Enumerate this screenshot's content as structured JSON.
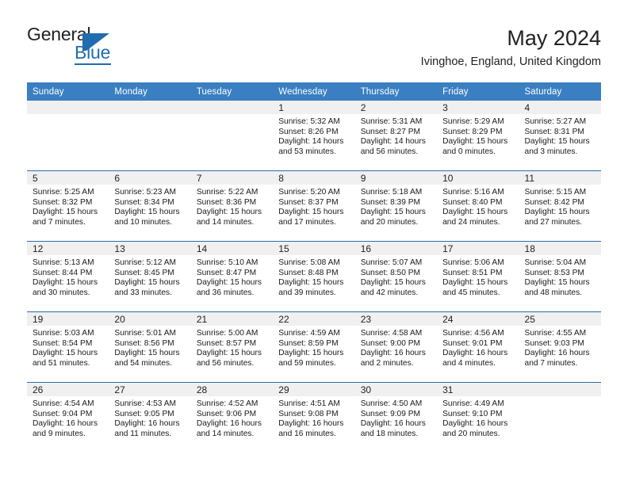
{
  "brand": {
    "name_top": "General",
    "name_bottom": "Blue",
    "accent_color": "#1f6cb0"
  },
  "header": {
    "title": "May 2024",
    "location": "Ivinghoe, England, United Kingdom"
  },
  "theme": {
    "header_blue": "#3a7fc1",
    "rule_blue": "#2b6cab",
    "daynum_band": "#f0f0f0"
  },
  "weekday_headers": [
    "Sunday",
    "Monday",
    "Tuesday",
    "Wednesday",
    "Thursday",
    "Friday",
    "Saturday"
  ],
  "weeks": [
    [
      {
        "day": "",
        "sunrise": "",
        "sunset": "",
        "daylight1": "",
        "daylight2": ""
      },
      {
        "day": "",
        "sunrise": "",
        "sunset": "",
        "daylight1": "",
        "daylight2": ""
      },
      {
        "day": "",
        "sunrise": "",
        "sunset": "",
        "daylight1": "",
        "daylight2": ""
      },
      {
        "day": "1",
        "sunrise": "Sunrise: 5:32 AM",
        "sunset": "Sunset: 8:26 PM",
        "daylight1": "Daylight: 14 hours",
        "daylight2": "and 53 minutes."
      },
      {
        "day": "2",
        "sunrise": "Sunrise: 5:31 AM",
        "sunset": "Sunset: 8:27 PM",
        "daylight1": "Daylight: 14 hours",
        "daylight2": "and 56 minutes."
      },
      {
        "day": "3",
        "sunrise": "Sunrise: 5:29 AM",
        "sunset": "Sunset: 8:29 PM",
        "daylight1": "Daylight: 15 hours",
        "daylight2": "and 0 minutes."
      },
      {
        "day": "4",
        "sunrise": "Sunrise: 5:27 AM",
        "sunset": "Sunset: 8:31 PM",
        "daylight1": "Daylight: 15 hours",
        "daylight2": "and 3 minutes."
      }
    ],
    [
      {
        "day": "5",
        "sunrise": "Sunrise: 5:25 AM",
        "sunset": "Sunset: 8:32 PM",
        "daylight1": "Daylight: 15 hours",
        "daylight2": "and 7 minutes."
      },
      {
        "day": "6",
        "sunrise": "Sunrise: 5:23 AM",
        "sunset": "Sunset: 8:34 PM",
        "daylight1": "Daylight: 15 hours",
        "daylight2": "and 10 minutes."
      },
      {
        "day": "7",
        "sunrise": "Sunrise: 5:22 AM",
        "sunset": "Sunset: 8:36 PM",
        "daylight1": "Daylight: 15 hours",
        "daylight2": "and 14 minutes."
      },
      {
        "day": "8",
        "sunrise": "Sunrise: 5:20 AM",
        "sunset": "Sunset: 8:37 PM",
        "daylight1": "Daylight: 15 hours",
        "daylight2": "and 17 minutes."
      },
      {
        "day": "9",
        "sunrise": "Sunrise: 5:18 AM",
        "sunset": "Sunset: 8:39 PM",
        "daylight1": "Daylight: 15 hours",
        "daylight2": "and 20 minutes."
      },
      {
        "day": "10",
        "sunrise": "Sunrise: 5:16 AM",
        "sunset": "Sunset: 8:40 PM",
        "daylight1": "Daylight: 15 hours",
        "daylight2": "and 24 minutes."
      },
      {
        "day": "11",
        "sunrise": "Sunrise: 5:15 AM",
        "sunset": "Sunset: 8:42 PM",
        "daylight1": "Daylight: 15 hours",
        "daylight2": "and 27 minutes."
      }
    ],
    [
      {
        "day": "12",
        "sunrise": "Sunrise: 5:13 AM",
        "sunset": "Sunset: 8:44 PM",
        "daylight1": "Daylight: 15 hours",
        "daylight2": "and 30 minutes."
      },
      {
        "day": "13",
        "sunrise": "Sunrise: 5:12 AM",
        "sunset": "Sunset: 8:45 PM",
        "daylight1": "Daylight: 15 hours",
        "daylight2": "and 33 minutes."
      },
      {
        "day": "14",
        "sunrise": "Sunrise: 5:10 AM",
        "sunset": "Sunset: 8:47 PM",
        "daylight1": "Daylight: 15 hours",
        "daylight2": "and 36 minutes."
      },
      {
        "day": "15",
        "sunrise": "Sunrise: 5:08 AM",
        "sunset": "Sunset: 8:48 PM",
        "daylight1": "Daylight: 15 hours",
        "daylight2": "and 39 minutes."
      },
      {
        "day": "16",
        "sunrise": "Sunrise: 5:07 AM",
        "sunset": "Sunset: 8:50 PM",
        "daylight1": "Daylight: 15 hours",
        "daylight2": "and 42 minutes."
      },
      {
        "day": "17",
        "sunrise": "Sunrise: 5:06 AM",
        "sunset": "Sunset: 8:51 PM",
        "daylight1": "Daylight: 15 hours",
        "daylight2": "and 45 minutes."
      },
      {
        "day": "18",
        "sunrise": "Sunrise: 5:04 AM",
        "sunset": "Sunset: 8:53 PM",
        "daylight1": "Daylight: 15 hours",
        "daylight2": "and 48 minutes."
      }
    ],
    [
      {
        "day": "19",
        "sunrise": "Sunrise: 5:03 AM",
        "sunset": "Sunset: 8:54 PM",
        "daylight1": "Daylight: 15 hours",
        "daylight2": "and 51 minutes."
      },
      {
        "day": "20",
        "sunrise": "Sunrise: 5:01 AM",
        "sunset": "Sunset: 8:56 PM",
        "daylight1": "Daylight: 15 hours",
        "daylight2": "and 54 minutes."
      },
      {
        "day": "21",
        "sunrise": "Sunrise: 5:00 AM",
        "sunset": "Sunset: 8:57 PM",
        "daylight1": "Daylight: 15 hours",
        "daylight2": "and 56 minutes."
      },
      {
        "day": "22",
        "sunrise": "Sunrise: 4:59 AM",
        "sunset": "Sunset: 8:59 PM",
        "daylight1": "Daylight: 15 hours",
        "daylight2": "and 59 minutes."
      },
      {
        "day": "23",
        "sunrise": "Sunrise: 4:58 AM",
        "sunset": "Sunset: 9:00 PM",
        "daylight1": "Daylight: 16 hours",
        "daylight2": "and 2 minutes."
      },
      {
        "day": "24",
        "sunrise": "Sunrise: 4:56 AM",
        "sunset": "Sunset: 9:01 PM",
        "daylight1": "Daylight: 16 hours",
        "daylight2": "and 4 minutes."
      },
      {
        "day": "25",
        "sunrise": "Sunrise: 4:55 AM",
        "sunset": "Sunset: 9:03 PM",
        "daylight1": "Daylight: 16 hours",
        "daylight2": "and 7 minutes."
      }
    ],
    [
      {
        "day": "26",
        "sunrise": "Sunrise: 4:54 AM",
        "sunset": "Sunset: 9:04 PM",
        "daylight1": "Daylight: 16 hours",
        "daylight2": "and 9 minutes."
      },
      {
        "day": "27",
        "sunrise": "Sunrise: 4:53 AM",
        "sunset": "Sunset: 9:05 PM",
        "daylight1": "Daylight: 16 hours",
        "daylight2": "and 11 minutes."
      },
      {
        "day": "28",
        "sunrise": "Sunrise: 4:52 AM",
        "sunset": "Sunset: 9:06 PM",
        "daylight1": "Daylight: 16 hours",
        "daylight2": "and 14 minutes."
      },
      {
        "day": "29",
        "sunrise": "Sunrise: 4:51 AM",
        "sunset": "Sunset: 9:08 PM",
        "daylight1": "Daylight: 16 hours",
        "daylight2": "and 16 minutes."
      },
      {
        "day": "30",
        "sunrise": "Sunrise: 4:50 AM",
        "sunset": "Sunset: 9:09 PM",
        "daylight1": "Daylight: 16 hours",
        "daylight2": "and 18 minutes."
      },
      {
        "day": "31",
        "sunrise": "Sunrise: 4:49 AM",
        "sunset": "Sunset: 9:10 PM",
        "daylight1": "Daylight: 16 hours",
        "daylight2": "and 20 minutes."
      },
      {
        "day": "",
        "sunrise": "",
        "sunset": "",
        "daylight1": "",
        "daylight2": ""
      }
    ]
  ]
}
